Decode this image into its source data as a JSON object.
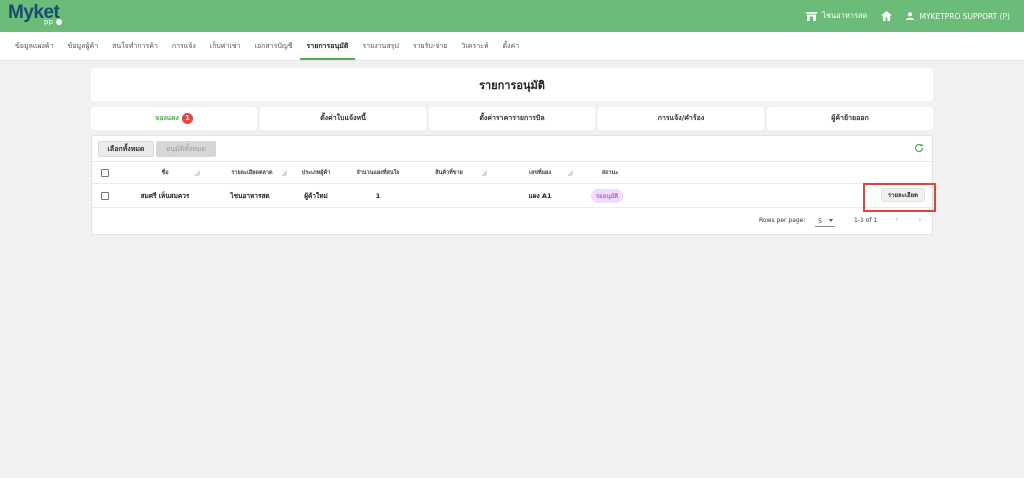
{
  "brand": {
    "name": "Myket",
    "sub": "pp"
  },
  "topbar": {
    "shop_label": "ไชนอาหารสด",
    "user_label": "MYKETPRO SUPPORT (P)"
  },
  "nav": {
    "tabs": [
      {
        "label": "ข้อมูลแผงค้า"
      },
      {
        "label": "ข้อมูลผู้ค้า"
      },
      {
        "label": "สนใจทำการค้า"
      },
      {
        "label": "การแจ้ง"
      },
      {
        "label": "เก็บค่าเช่า"
      },
      {
        "label": "เอกสารบัญชี"
      },
      {
        "label": "รายการอนุมัติ",
        "active": true
      },
      {
        "label": "รายงานสรุป"
      },
      {
        "label": "รายรับ-จ่าย"
      },
      {
        "label": "วิเคราะห์"
      },
      {
        "label": "ตั้งค่า"
      }
    ]
  },
  "page_title": "รายการอนุมัติ",
  "subtabs": [
    {
      "label": "จองแผง",
      "badge": "1",
      "active": true
    },
    {
      "label": "ตั้งค่าใบแจ้งหนี้"
    },
    {
      "label": "ตั้งค่าราคารายการบิล"
    },
    {
      "label": "การแจ้ง/คำร้อง"
    },
    {
      "label": "ผู้ค้าย้ายออก"
    }
  ],
  "toolbar": {
    "select_all": "เลือกทั้งหมด",
    "approve_all": "อนุมัติทั้งหมด"
  },
  "table": {
    "headers": [
      "ชื่อ",
      "รายละเอียดตลาด",
      "ประเภทผู้ค้า",
      "จำนวนแผงที่สนใจ",
      "สินค้าที่ขาย",
      "เลขที่แผง",
      "สถานะ"
    ],
    "rows": [
      {
        "name": "สมศรี เห็นสมควร",
        "market": "ไชนอาหารสด",
        "vendor_type": "ผู้ค้าใหม่",
        "stalls": "1",
        "product": "",
        "stall_no": "แผง A1",
        "status": "รออนุมัติ",
        "action": "รายละเอียด"
      }
    ]
  },
  "pagination": {
    "rows_per_page_label": "Rows per page:",
    "rows_per_page": "5",
    "range": "1-1 of 1"
  },
  "colors": {
    "brand_green": "#6bbc79",
    "accent_green": "#4caf50",
    "badge_red": "#e2463e",
    "status_purple": "#b066d8",
    "highlight_red": "#d9463a"
  }
}
